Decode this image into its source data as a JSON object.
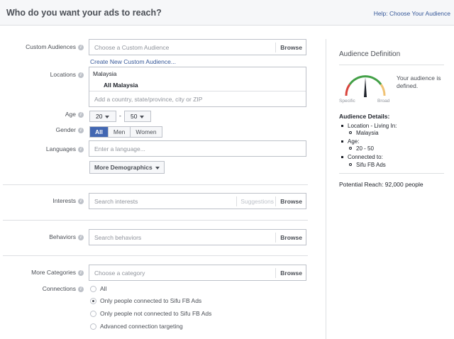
{
  "header": {
    "title": "Who do you want your ads to reach?",
    "help_link": "Help: Choose Your Audience"
  },
  "form": {
    "custom_audiences": {
      "label": "Custom Audiences",
      "placeholder": "Choose a Custom Audience",
      "browse": "Browse",
      "create_link": "Create New Custom Audience..."
    },
    "locations": {
      "label": "Locations",
      "country": "Malaysia",
      "selected": "All Malaysia",
      "placeholder": "Add a country, state/province, city or ZIP"
    },
    "age": {
      "label": "Age",
      "min": "20",
      "separator": "-",
      "max": "50"
    },
    "gender": {
      "label": "Gender",
      "options": [
        "All",
        "Men",
        "Women"
      ],
      "selected": "All"
    },
    "languages": {
      "label": "Languages",
      "placeholder": "Enter a language...",
      "more_button": "More Demographics"
    },
    "interests": {
      "label": "Interests",
      "placeholder": "Search interests",
      "suggestions": "Suggestions",
      "browse": "Browse"
    },
    "behaviors": {
      "label": "Behaviors",
      "placeholder": "Search behaviors",
      "browse": "Browse"
    },
    "more_categories": {
      "label": "More Categories",
      "placeholder": "Choose a category",
      "browse": "Browse"
    },
    "connections": {
      "label": "Connections",
      "options": [
        "All",
        "Only people connected to Sifu FB Ads",
        "Only people not connected to Sifu FB Ads",
        "Advanced connection targeting"
      ],
      "selected_index": 1
    }
  },
  "sidebar": {
    "title": "Audience Definition",
    "gauge_text": "Your audience is defined.",
    "specific": "Specific",
    "broad": "Broad",
    "details_title": "Audience Details:",
    "details": [
      {
        "item": "Location - Living In:",
        "sub": "Malaysia"
      },
      {
        "item": "Age:",
        "sub": "20 - 50"
      },
      {
        "item": "Connected to:",
        "sub": "Sifu FB Ads"
      }
    ],
    "potential_reach": "Potential Reach: 92,000 people"
  },
  "colors": {
    "accent": "#4267b2",
    "link": "#365899",
    "gauge_green": "#43a047",
    "gauge_red": "#d9453d",
    "gauge_yellow": "#f0c274"
  }
}
